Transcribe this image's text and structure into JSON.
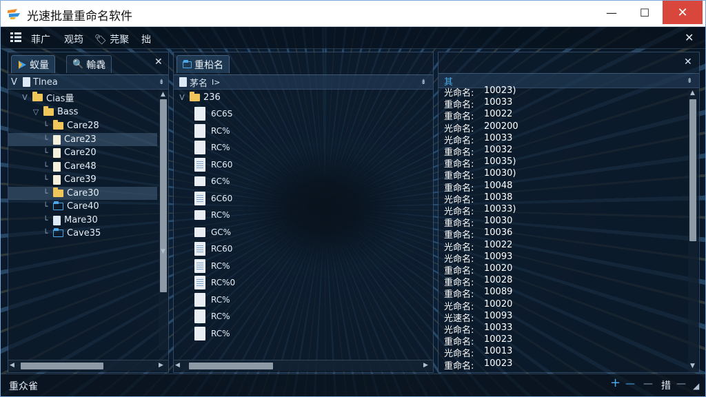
{
  "window": {
    "title": "光速批量重命名软件"
  },
  "titlebar": {
    "min": "—",
    "max": "☐",
    "close": "✕"
  },
  "menu": {
    "items": [
      "菲广",
      "观筠",
      "芫聚",
      "拙"
    ],
    "close": "✕"
  },
  "left_panel": {
    "tabs": [
      "蚁量",
      "輸毳"
    ],
    "close": "✕",
    "root": "Tlnea",
    "tree": [
      {
        "label": "Cias量",
        "level": 1,
        "type": "folder",
        "expander": "V"
      },
      {
        "label": "Bass",
        "level": 2,
        "type": "folder",
        "expander": "▽"
      },
      {
        "label": "Care28",
        "level": 3,
        "type": "folder",
        "selected": false
      },
      {
        "label": "Care23",
        "level": 3,
        "type": "doc",
        "selected": true
      },
      {
        "label": "Care20",
        "level": 3,
        "type": "doc",
        "selected": false
      },
      {
        "label": "Care48",
        "level": 3,
        "type": "doc",
        "selected": false
      },
      {
        "label": "Care39",
        "level": 3,
        "type": "doc",
        "selected": false
      },
      {
        "label": "Care30",
        "level": 3,
        "type": "folder",
        "selected": true
      },
      {
        "label": "Care40",
        "level": 3,
        "type": "folder-blue",
        "selected": false
      },
      {
        "label": "Mare30",
        "level": 3,
        "type": "doc-blue",
        "selected": false
      },
      {
        "label": "Cave35",
        "level": 3,
        "type": "folder-blue",
        "selected": false
      }
    ]
  },
  "middle_panel": {
    "tab": "重柗名",
    "header": "茅名",
    "header_mark": "Ⅰ>",
    "folder": "236",
    "files": [
      {
        "name": "6C6S",
        "icon": "plain"
      },
      {
        "name": "RC%",
        "icon": "plain"
      },
      {
        "name": "RC%",
        "icon": "plain"
      },
      {
        "name": "RC60",
        "icon": "lines"
      },
      {
        "name": "6C%",
        "icon": "fold"
      },
      {
        "name": "6C60",
        "icon": "lines"
      },
      {
        "name": "RC%",
        "icon": "fold"
      },
      {
        "name": "GC%",
        "icon": "fold"
      },
      {
        "name": "RC60",
        "icon": "lines"
      },
      {
        "name": "RC%",
        "icon": "lines"
      },
      {
        "name": "RC%0",
        "icon": "lines"
      },
      {
        "name": "RC%",
        "icon": "plain"
      },
      {
        "name": "RC%",
        "icon": "plain"
      },
      {
        "name": "RC%",
        "icon": "plain"
      }
    ]
  },
  "right_panel": {
    "close": "✕",
    "header": "其",
    "results": [
      {
        "label": "光命名:",
        "value": "10023)"
      },
      {
        "label": "重命名:",
        "value": "10033"
      },
      {
        "label": "重命名:",
        "value": "10022"
      },
      {
        "label": "光命名:",
        "value": "200200"
      },
      {
        "label": "光命名:",
        "value": "10033"
      },
      {
        "label": "重命名:",
        "value": "10032"
      },
      {
        "label": "重命名:",
        "value": "10035)"
      },
      {
        "label": "重命名:",
        "value": "10030)"
      },
      {
        "label": "重命名:",
        "value": "10048"
      },
      {
        "label": "光命名:",
        "value": "10038"
      },
      {
        "label": "光命名:",
        "value": "10033)"
      },
      {
        "label": "重命名:",
        "value": "10030"
      },
      {
        "label": "重命名:",
        "value": "10036"
      },
      {
        "label": "光命名:",
        "value": "10022"
      },
      {
        "label": "光命名:",
        "value": "10093"
      },
      {
        "label": "重命名:",
        "value": "10020"
      },
      {
        "label": "重命名:",
        "value": "10028"
      },
      {
        "label": "重命名:",
        "value": "10089"
      },
      {
        "label": "光命名:",
        "value": "10020"
      },
      {
        "label": "光速名:",
        "value": "10093"
      },
      {
        "label": "光命名:",
        "value": "10033"
      },
      {
        "label": "重命名:",
        "value": "10023"
      },
      {
        "label": "光命名:",
        "value": "10013"
      },
      {
        "label": "重命名:",
        "value": "10023"
      }
    ]
  },
  "status": {
    "text": "重众雀",
    "right_label": "措",
    "plus": "+",
    "dash": "—"
  },
  "colors": {
    "accent": "#4aa8e8",
    "folder": "#f0c55a",
    "close_red": "#d9463b"
  }
}
